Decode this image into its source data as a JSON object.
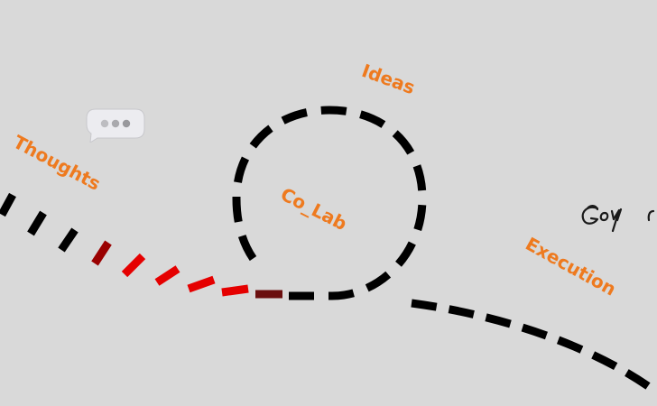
{
  "diagram": {
    "labels": {
      "ideas": "Ideas",
      "thoughts": "Thoughts",
      "co_lab": "Co_Lab",
      "execution": "Execution"
    },
    "colors": {
      "background": "#d9d9d9",
      "label": "#ee7a1f",
      "dash_black": "#000000",
      "dash_red": "#e50000",
      "dash_dark_red": "#9a0000",
      "dash_maroon": "#6b0f0f"
    },
    "icons": {
      "chat_bubble": "typing-bubble-icon",
      "signature": "scribble-logo-icon"
    }
  }
}
